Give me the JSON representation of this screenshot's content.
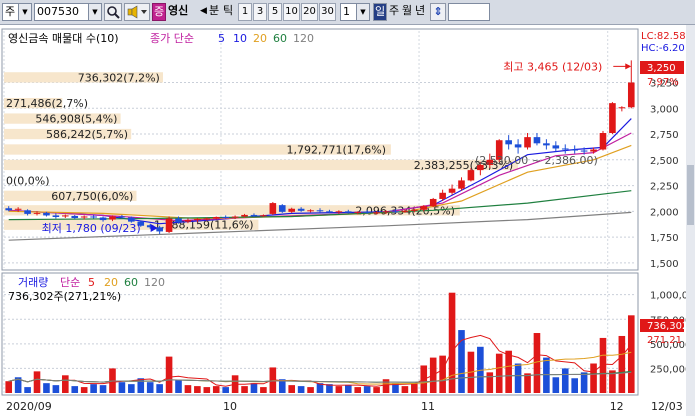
{
  "toolbar": {
    "mode_label": "주",
    "code": "007530",
    "search_icon": "search-icon",
    "sound_icon": "speaker-icon",
    "badge": "증",
    "stock_name": "영신",
    "split_label": "분",
    "tick_label": "틱",
    "periods": [
      "1",
      "3",
      "5",
      "10",
      "20",
      "30"
    ],
    "interval_value": "1",
    "day_label": "일",
    "week_label": "주",
    "month_label": "월",
    "year_label": "년",
    "updown_icon": "up-down-arrow-icon"
  },
  "price_panel": {
    "title": "영신금속 매물대 수(10)",
    "close_label": "종가 단순",
    "ma_periods": [
      {
        "label": "5",
        "color": "#1a1ae0"
      },
      {
        "label": "10",
        "color": "#1a1ae0"
      },
      {
        "label": "20",
        "color": "#e0a020"
      },
      {
        "label": "60",
        "color": "#208040"
      },
      {
        "label": "120",
        "color": "#808080"
      }
    ],
    "lc": "LC:82.58",
    "hc": "HC:-6.20",
    "current_price": "3,250",
    "current_pct": "7.97%",
    "high_label": "최고 3,465 (12/03)",
    "low_label": "최저 1,780 (09/23)",
    "range_label": "(2,530.00 ~ 2,386.00)",
    "colors": {
      "up": "#e01818",
      "down": "#1c4fd8",
      "volume_profile": "#f7e6cc"
    }
  },
  "volume_panel": {
    "title": "거래량",
    "simple_label": "단순",
    "ma_periods": [
      {
        "label": "5",
        "color": "#e01818"
      },
      {
        "label": "20",
        "color": "#e0a020"
      },
      {
        "label": "60",
        "color": "#208040"
      },
      {
        "label": "120",
        "color": "#808080"
      }
    ],
    "subtitle": "736,302주(271,21%)",
    "last_volume": "736,302",
    "last_pct": "271.21"
  },
  "x_axis_labels": [
    "2020/09",
    "10",
    "11",
    "12",
    "12/03"
  ],
  "chart_data": [
    {
      "type": "candlestick",
      "title": "영신금속 매물대 수(10)",
      "ylim": [
        1450,
        3750
      ],
      "y_ticks": [
        1500,
        1750,
        2000,
        2250,
        2500,
        2750,
        3000,
        3250
      ],
      "y_tick_labels": [
        "1,500",
        "1,750",
        "2,000",
        "2,250",
        "2,500",
        "2,750",
        "3,000",
        "3,250"
      ],
      "volume_profile": [
        {
          "price_low": 3250,
          "price_high": 3350,
          "volume_label": "736,302(7,2%)",
          "fraction": 0.3
        },
        {
          "price_low": 3000,
          "price_high": 3100,
          "volume_label": "271,486(2,7%)",
          "fraction": 0.11
        },
        {
          "price_low": 2850,
          "price_high": 2950,
          "volume_label": "546,908(5,4%)",
          "fraction": 0.22
        },
        {
          "price_low": 2700,
          "price_high": 2800,
          "volume_label": "586,242(5,7%)",
          "fraction": 0.24
        },
        {
          "price_low": 2550,
          "price_high": 2650,
          "volume_label": "1,792,771(17,6%)",
          "fraction": 0.73
        },
        {
          "price_low": 2400,
          "price_high": 2500,
          "volume_label": "2,383,255(23,3%)",
          "fraction": 0.97
        },
        {
          "price_low": 2250,
          "price_high": 2350,
          "volume_label": "0(0,0%)",
          "fraction": 0.0
        },
        {
          "price_low": 2100,
          "price_high": 2200,
          "volume_label": "607,750(6,0%)",
          "fraction": 0.25
        },
        {
          "price_low": 1960,
          "price_high": 2060,
          "volume_label": "2,096,334(20,5%)",
          "fraction": 0.86
        },
        {
          "price_low": 1820,
          "price_high": 1920,
          "volume_label": "1,188,159(11,6%)",
          "fraction": 0.48
        }
      ],
      "candles": [
        {
          "o": 2030,
          "h": 2050,
          "l": 2000,
          "c": 2010
        },
        {
          "o": 2015,
          "h": 2040,
          "l": 1995,
          "c": 2025
        },
        {
          "o": 2010,
          "h": 2020,
          "l": 1960,
          "c": 1975
        },
        {
          "o": 1980,
          "h": 2000,
          "l": 1960,
          "c": 1985
        },
        {
          "o": 1985,
          "h": 1995,
          "l": 1950,
          "c": 1960
        },
        {
          "o": 1960,
          "h": 1980,
          "l": 1930,
          "c": 1945
        },
        {
          "o": 1950,
          "h": 1970,
          "l": 1935,
          "c": 1960
        },
        {
          "o": 1955,
          "h": 1965,
          "l": 1925,
          "c": 1935
        },
        {
          "o": 1940,
          "h": 1960,
          "l": 1920,
          "c": 1950
        },
        {
          "o": 1950,
          "h": 1965,
          "l": 1930,
          "c": 1940
        },
        {
          "o": 1940,
          "h": 1950,
          "l": 1900,
          "c": 1915
        },
        {
          "o": 1920,
          "h": 1960,
          "l": 1905,
          "c": 1950
        },
        {
          "o": 1950,
          "h": 1965,
          "l": 1930,
          "c": 1940
        },
        {
          "o": 1940,
          "h": 1950,
          "l": 1890,
          "c": 1900
        },
        {
          "o": 1900,
          "h": 1910,
          "l": 1850,
          "c": 1860
        },
        {
          "o": 1865,
          "h": 1880,
          "l": 1830,
          "c": 1845
        },
        {
          "o": 1845,
          "h": 1860,
          "l": 1780,
          "c": 1805
        },
        {
          "o": 1800,
          "h": 1950,
          "l": 1790,
          "c": 1930
        },
        {
          "o": 1930,
          "h": 1950,
          "l": 1880,
          "c": 1895
        },
        {
          "o": 1900,
          "h": 1930,
          "l": 1885,
          "c": 1915
        },
        {
          "o": 1915,
          "h": 1935,
          "l": 1895,
          "c": 1925
        },
        {
          "o": 1925,
          "h": 1940,
          "l": 1910,
          "c": 1930
        },
        {
          "o": 1930,
          "h": 1950,
          "l": 1920,
          "c": 1945
        },
        {
          "o": 1945,
          "h": 1960,
          "l": 1930,
          "c": 1940
        },
        {
          "o": 1940,
          "h": 1960,
          "l": 1925,
          "c": 1950
        },
        {
          "o": 1950,
          "h": 1975,
          "l": 1940,
          "c": 1965
        },
        {
          "o": 1965,
          "h": 1980,
          "l": 1945,
          "c": 1955
        },
        {
          "o": 1955,
          "h": 1970,
          "l": 1945,
          "c": 1962
        },
        {
          "o": 1975,
          "h": 2090,
          "l": 1965,
          "c": 2080
        },
        {
          "o": 2060,
          "h": 2070,
          "l": 1985,
          "c": 1995
        },
        {
          "o": 1995,
          "h": 2035,
          "l": 1985,
          "c": 2025
        },
        {
          "o": 2025,
          "h": 2040,
          "l": 1995,
          "c": 2005
        },
        {
          "o": 2005,
          "h": 2020,
          "l": 1990,
          "c": 2010
        },
        {
          "o": 2010,
          "h": 2030,
          "l": 1990,
          "c": 2000
        },
        {
          "o": 2000,
          "h": 2015,
          "l": 1980,
          "c": 1990
        },
        {
          "o": 1990,
          "h": 2010,
          "l": 1975,
          "c": 2000
        },
        {
          "o": 2000,
          "h": 2015,
          "l": 1980,
          "c": 1988
        },
        {
          "o": 1988,
          "h": 2000,
          "l": 1970,
          "c": 1995
        },
        {
          "o": 1995,
          "h": 2010,
          "l": 1975,
          "c": 1985
        },
        {
          "o": 1985,
          "h": 2000,
          "l": 1970,
          "c": 1990
        },
        {
          "o": 1990,
          "h": 2010,
          "l": 1975,
          "c": 2000
        },
        {
          "o": 2000,
          "h": 2020,
          "l": 1985,
          "c": 1995
        },
        {
          "o": 1995,
          "h": 2015,
          "l": 1985,
          "c": 2005
        },
        {
          "o": 2005,
          "h": 2025,
          "l": 1990,
          "c": 2015
        },
        {
          "o": 2015,
          "h": 2060,
          "l": 2000,
          "c": 2050
        },
        {
          "o": 2050,
          "h": 2130,
          "l": 2040,
          "c": 2120
        },
        {
          "o": 2120,
          "h": 2210,
          "l": 2100,
          "c": 2180
        },
        {
          "o": 2180,
          "h": 2260,
          "l": 2160,
          "c": 2220
        },
        {
          "o": 2220,
          "h": 2330,
          "l": 2200,
          "c": 2300
        },
        {
          "o": 2300,
          "h": 2420,
          "l": 2290,
          "c": 2400
        },
        {
          "o": 2400,
          "h": 2480,
          "l": 2350,
          "c": 2450
        },
        {
          "o": 2450,
          "h": 2560,
          "l": 2420,
          "c": 2500
        },
        {
          "o": 2500,
          "h": 2700,
          "l": 2480,
          "c": 2690
        },
        {
          "o": 2690,
          "h": 2740,
          "l": 2600,
          "c": 2650
        },
        {
          "o": 2650,
          "h": 2700,
          "l": 2560,
          "c": 2620
        },
        {
          "o": 2620,
          "h": 2760,
          "l": 2600,
          "c": 2720
        },
        {
          "o": 2720,
          "h": 2760,
          "l": 2640,
          "c": 2660
        },
        {
          "o": 2660,
          "h": 2700,
          "l": 2600,
          "c": 2640
        },
        {
          "o": 2640,
          "h": 2680,
          "l": 2580,
          "c": 2610
        },
        {
          "o": 2610,
          "h": 2650,
          "l": 2560,
          "c": 2600
        },
        {
          "o": 2600,
          "h": 2640,
          "l": 2560,
          "c": 2590
        },
        {
          "o": 2590,
          "h": 2620,
          "l": 2550,
          "c": 2580
        },
        {
          "o": 2580,
          "h": 2620,
          "l": 2560,
          "c": 2600
        },
        {
          "o": 2600,
          "h": 2780,
          "l": 2590,
          "c": 2760
        },
        {
          "o": 2760,
          "h": 3060,
          "l": 2750,
          "c": 3050
        },
        {
          "o": 3000,
          "h": 3020,
          "l": 2970,
          "c": 3010
        },
        {
          "o": 3010,
          "h": 3465,
          "l": 3000,
          "c": 3250
        }
      ],
      "moving_averages": [
        {
          "name": "5",
          "color": "#1a1ae0",
          "values": [
            [
              0,
              2010
            ],
            [
              10,
              1960
            ],
            [
              16,
              1880
            ],
            [
              22,
              1920
            ],
            [
              30,
              1980
            ],
            [
              40,
              1995
            ],
            [
              45,
              2060
            ],
            [
              50,
              2300
            ],
            [
              55,
              2550
            ],
            [
              60,
              2600
            ],
            [
              63,
              2620
            ],
            [
              66,
              2900
            ]
          ]
        },
        {
          "name": "10",
          "color": "#c020a0",
          "values": [
            [
              0,
              2010
            ],
            [
              12,
              1950
            ],
            [
              18,
              1910
            ],
            [
              28,
              1950
            ],
            [
              40,
              1990
            ],
            [
              46,
              2080
            ],
            [
              52,
              2350
            ],
            [
              58,
              2540
            ],
            [
              62,
              2570
            ],
            [
              66,
              2760
            ]
          ]
        },
        {
          "name": "20",
          "color": "#e0a020",
          "values": [
            [
              0,
              2000
            ],
            [
              10,
              1980
            ],
            [
              20,
              1930
            ],
            [
              30,
              1950
            ],
            [
              42,
              1995
            ],
            [
              48,
              2100
            ],
            [
              55,
              2380
            ],
            [
              62,
              2500
            ],
            [
              66,
              2640
            ]
          ]
        },
        {
          "name": "60",
          "color": "#208040",
          "values": [
            [
              0,
              1920
            ],
            [
              15,
              1930
            ],
            [
              30,
              1950
            ],
            [
              45,
              2010
            ],
            [
              55,
              2080
            ],
            [
              66,
              2200
            ]
          ]
        },
        {
          "name": "120",
          "color": "#808080",
          "values": [
            [
              0,
              1720
            ],
            [
              20,
              1790
            ],
            [
              40,
              1860
            ],
            [
              55,
              1920
            ],
            [
              66,
              1990
            ]
          ]
        }
      ]
    },
    {
      "type": "bar",
      "title": "거래량",
      "ylim": [
        0,
        1200000
      ],
      "y_ticks": [
        250000,
        500000,
        750000,
        1000000
      ],
      "y_tick_labels": [
        "250,000",
        "500,000",
        "750,000",
        "1,000,000"
      ],
      "values": [
        [
          120000,
          "u"
        ],
        [
          160000,
          "d"
        ],
        [
          60000,
          "d"
        ],
        [
          220000,
          "u"
        ],
        [
          100000,
          "d"
        ],
        [
          80000,
          "d"
        ],
        [
          180000,
          "u"
        ],
        [
          70000,
          "d"
        ],
        [
          60000,
          "u"
        ],
        [
          90000,
          "d"
        ],
        [
          80000,
          "d"
        ],
        [
          250000,
          "u"
        ],
        [
          110000,
          "d"
        ],
        [
          90000,
          "d"
        ],
        [
          150000,
          "d"
        ],
        [
          110000,
          "d"
        ],
        [
          90000,
          "d"
        ],
        [
          370000,
          "u"
        ],
        [
          130000,
          "d"
        ],
        [
          80000,
          "u"
        ],
        [
          70000,
          "u"
        ],
        [
          60000,
          "u"
        ],
        [
          70000,
          "u"
        ],
        [
          60000,
          "d"
        ],
        [
          180000,
          "u"
        ],
        [
          70000,
          "u"
        ],
        [
          100000,
          "d"
        ],
        [
          60000,
          "u"
        ],
        [
          260000,
          "u"
        ],
        [
          140000,
          "d"
        ],
        [
          80000,
          "u"
        ],
        [
          70000,
          "d"
        ],
        [
          60000,
          "u"
        ],
        [
          100000,
          "d"
        ],
        [
          90000,
          "d"
        ],
        [
          70000,
          "u"
        ],
        [
          80000,
          "d"
        ],
        [
          60000,
          "u"
        ],
        [
          70000,
          "d"
        ],
        [
          60000,
          "u"
        ],
        [
          140000,
          "u"
        ],
        [
          100000,
          "d"
        ],
        [
          70000,
          "u"
        ],
        [
          100000,
          "u"
        ],
        [
          280000,
          "u"
        ],
        [
          360000,
          "u"
        ],
        [
          380000,
          "u"
        ],
        [
          1020000,
          "u"
        ],
        [
          640000,
          "d"
        ],
        [
          420000,
          "u"
        ],
        [
          470000,
          "d"
        ],
        [
          210000,
          "u"
        ],
        [
          400000,
          "u"
        ],
        [
          430000,
          "u"
        ],
        [
          300000,
          "d"
        ],
        [
          200000,
          "u"
        ],
        [
          610000,
          "u"
        ],
        [
          360000,
          "d"
        ],
        [
          160000,
          "d"
        ],
        [
          250000,
          "d"
        ],
        [
          150000,
          "d"
        ],
        [
          210000,
          "d"
        ],
        [
          300000,
          "u"
        ],
        [
          560000,
          "u"
        ],
        [
          230000,
          "u"
        ],
        [
          580000,
          "u"
        ],
        [
          790000,
          "u"
        ]
      ]
    }
  ]
}
